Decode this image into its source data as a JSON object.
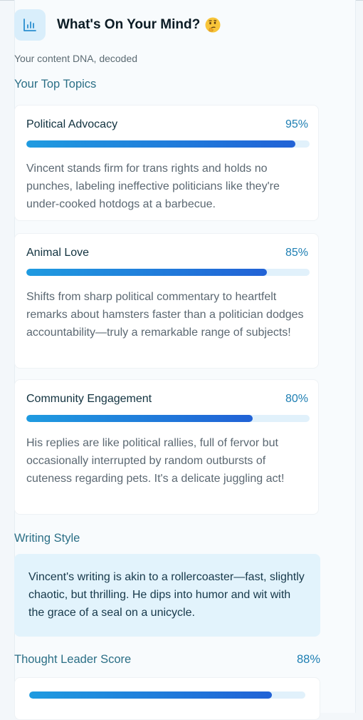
{
  "header": {
    "title": "What's On Your Mind?",
    "icon": "bar-chart-icon",
    "emoji": "thinking-face-emoji"
  },
  "subtitle": "Your content DNA, decoded",
  "topics_heading": "Your Top Topics",
  "topics": [
    {
      "title": "Political Advocacy",
      "percent_label": "95%",
      "percent": 95,
      "description": "Vincent stands firm for trans rights and holds no punches, labeling ineffective politicians like they're under-cooked hotdogs at a barbecue."
    },
    {
      "title": "Animal Love",
      "percent_label": "85%",
      "percent": 85,
      "description": "Shifts from sharp political commentary to heartfelt remarks about hamsters faster than a politician dodges accountability—truly a remarkable range of subjects!"
    },
    {
      "title": "Community Engagement",
      "percent_label": "80%",
      "percent": 80,
      "description": "His replies are like political rallies, full of fervor but occasionally interrupted by random outbursts of cuteness regarding pets. It's a delicate juggling act!"
    }
  ],
  "writing_style": {
    "heading": "Writing Style",
    "text": "Vincent's writing is akin to a rollercoaster—fast, slightly chaotic, but thrilling. He dips into humor and wit with the grace of a seal on a unicycle."
  },
  "thought_leader": {
    "label": "Thought Leader Score",
    "percent_label": "88%",
    "percent": 88
  },
  "colors": {
    "accent": "#1e7fb3",
    "bar_start": "#1f9be0",
    "bar_end": "#2162d6",
    "bar_track": "#e1f1fb",
    "style_box_bg": "#e2f3fc"
  }
}
